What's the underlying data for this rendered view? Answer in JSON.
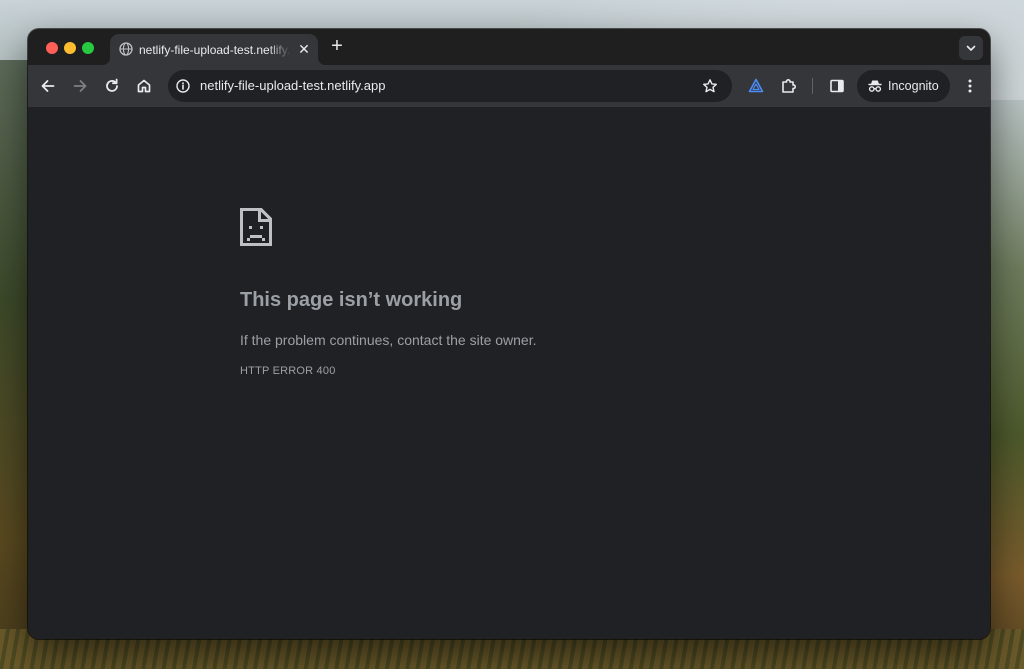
{
  "window": {
    "traffic_lights": {
      "close_color": "#ff5f57",
      "minimize_color": "#febc2e",
      "maximize_color": "#28c840"
    }
  },
  "tabs": [
    {
      "title": "netlify-file-upload-test.netlify.app",
      "favicon": "globe-icon",
      "active": true,
      "close_glyph": "✕"
    }
  ],
  "tabstrip": {
    "new_tab_glyph": "+",
    "tab_search_icon": "chevron-down-icon"
  },
  "toolbar": {
    "back_icon": "arrow-left-icon",
    "forward_icon": "arrow-right-icon",
    "forward_enabled": false,
    "reload_icon": "reload-icon",
    "home_icon": "home-icon",
    "omnibox": {
      "site_info_icon": "info-icon",
      "url": "netlify-file-upload-test.netlify.app",
      "bookmark_icon": "star-icon"
    },
    "extension_icon": "triangle-extension-icon",
    "extension_color": "#4b8df8",
    "extensions_menu_icon": "puzzle-icon",
    "side_panel_icon": "side-panel-icon",
    "profile": {
      "label": "Incognito",
      "icon": "incognito-icon"
    },
    "menu_icon": "more-vertical-icon"
  },
  "page": {
    "icon": "sad-page-icon",
    "title": "This page isn’t working",
    "message": "If the problem continues, contact the site owner.",
    "error_code": "HTTP ERROR 400"
  },
  "colors": {
    "frame": "#1f1f1f",
    "toolbar": "#35363a",
    "content_bg": "#202124",
    "text_primary": "#e8eaed",
    "text_secondary": "#9aa0a6"
  }
}
